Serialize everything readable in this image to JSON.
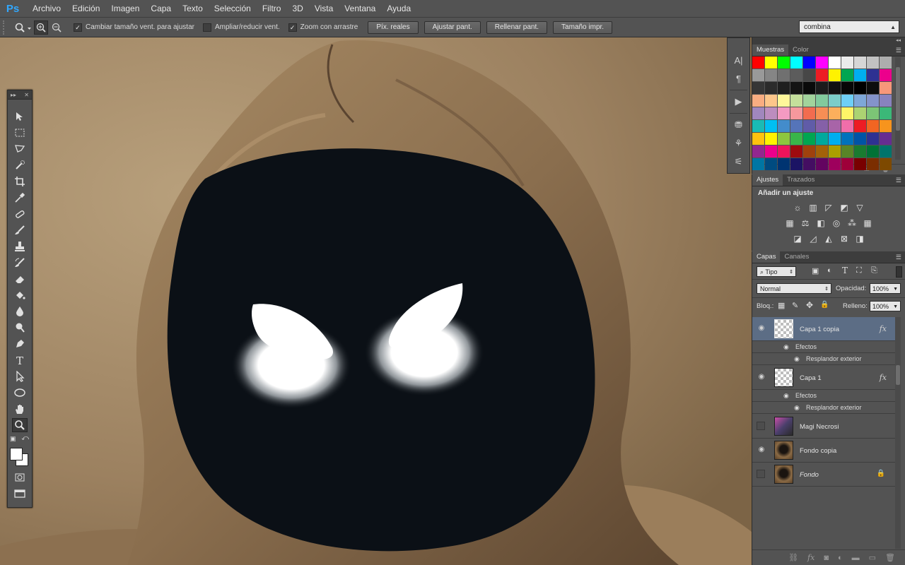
{
  "app": {
    "logo": "Ps"
  },
  "menu": [
    "Archivo",
    "Edición",
    "Imagen",
    "Capa",
    "Texto",
    "Selección",
    "Filtro",
    "3D",
    "Vista",
    "Ventana",
    "Ayuda"
  ],
  "options": {
    "resize_windows_label": "Cambiar tamaño vent. para ajustar",
    "resize_windows_checked": true,
    "zoom_all_label": "Ampliar/reducir vent.",
    "zoom_all_checked": false,
    "scrubby_zoom_label": "Zoom con arrastre",
    "scrubby_zoom_checked": true,
    "buttons": [
      "Píx. reales",
      "Ajustar pant.",
      "Rellenar pant.",
      "Tamaño impr."
    ],
    "workspace": "combina"
  },
  "swatches_panel": {
    "tabs": [
      "Muestras",
      "Color"
    ],
    "colors": [
      "#ff0000",
      "#ffff00",
      "#00ff00",
      "#00ffff",
      "#0000ff",
      "#ff00ff",
      "#ffffff",
      "#ebebeb",
      "#d6d6d6",
      "#c2c2c2",
      "#adadad",
      "#999999",
      "#858585",
      "#707070",
      "#5c5c5c",
      "#474747",
      "#ed1c24",
      "#fff200",
      "#00a651",
      "#00aeef",
      "#2e3192",
      "#ec008c",
      "#363636",
      "#2b2b2b",
      "#1f1f1f",
      "#141414",
      "#0a0a0a",
      "#1b1b1b",
      "#111111",
      "#070707",
      "#000000",
      "#0d0d0d",
      "#f7977a",
      "#f9ad81",
      "#fdc68a",
      "#fff79a",
      "#c4df9b",
      "#a2d39c",
      "#82ca9d",
      "#7bcdc8",
      "#6ecff6",
      "#7ea7d8",
      "#8493ca",
      "#8882be",
      "#a187be",
      "#bc8dbf",
      "#f49ac2",
      "#f6989d",
      "#f26c4f",
      "#f68e55",
      "#fbaf5c",
      "#fff467",
      "#acd372",
      "#7cc576",
      "#3bb878",
      "#1abbb4",
      "#00bff3",
      "#438ccb",
      "#5574b9",
      "#605ca8",
      "#8560a8",
      "#a864a8",
      "#f06eaa",
      "#ed1c24",
      "#f26522",
      "#f7941d",
      "#ffc20e",
      "#fff200",
      "#8dc63f",
      "#39b54a",
      "#00a651",
      "#00a99d",
      "#00aeef",
      "#0072bc",
      "#0054a6",
      "#2e3192",
      "#662d91",
      "#92278f",
      "#ec008c",
      "#ed145b",
      "#9e0b0f",
      "#a0410d",
      "#a36209",
      "#aba000",
      "#598527",
      "#1a7b30",
      "#007236",
      "#00746b",
      "#0076a3",
      "#004b80",
      "#003471",
      "#1b1464",
      "#440e62",
      "#630460",
      "#9e005d",
      "#9e0039",
      "#790000",
      "#7b2e00",
      "#7d4900"
    ]
  },
  "adjustments_panel": {
    "tabs": [
      "Ajustes",
      "Trazados"
    ],
    "title": "Añadir un ajuste"
  },
  "layers_panel": {
    "tabs": [
      "Capas",
      "Canales"
    ],
    "filter_kind": "Tipo",
    "blend_mode": "Normal",
    "opacity_label": "Opacidad:",
    "opacity": "100%",
    "lock_label": "Bloq.:",
    "fill_label": "Relleno:",
    "fill": "100%",
    "layers": [
      {
        "name": "Capa 1 copia",
        "visible": true,
        "selected": true,
        "fx": "fx",
        "effects_label": "Efectos",
        "effect": "Resplandor exterior"
      },
      {
        "name": "Capa 1",
        "visible": true,
        "selected": false,
        "fx": "fx",
        "effects_label": "Efectos",
        "effect": "Resplandor exterior"
      },
      {
        "name": "Magi Necrosi",
        "visible": false,
        "selected": false
      },
      {
        "name": "Fondo copia",
        "visible": true,
        "selected": false
      },
      {
        "name": "Fondo",
        "visible": false,
        "selected": false,
        "locked": true
      }
    ]
  }
}
